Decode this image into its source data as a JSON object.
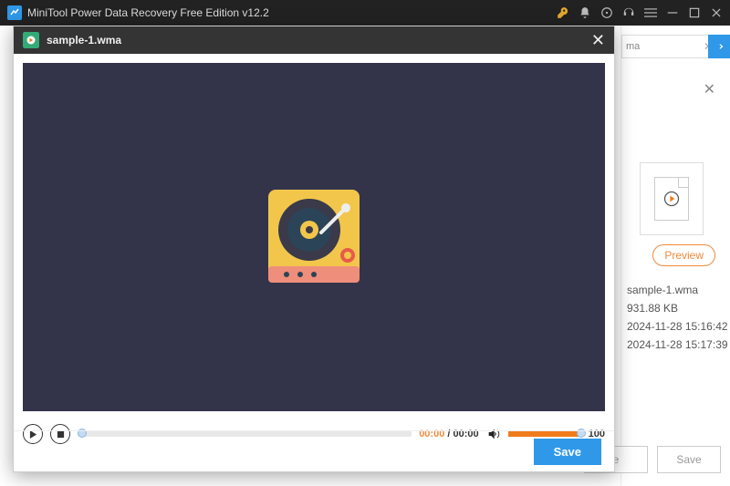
{
  "app": {
    "title": "MiniTool Power Data Recovery Free Edition v12.2"
  },
  "sidebar": {
    "search_fragment": "ma",
    "preview_label": "Preview",
    "file": {
      "name": "sample-1.wma",
      "size": "931.88 KB",
      "date1": "2024-11-28 15:16:42",
      "date2": "2024-11-28 15:17:39"
    },
    "recover_label": "e",
    "save_label": "Save"
  },
  "modal": {
    "filename": "sample-1.wma",
    "current_time": "00:00",
    "duration": "00:00",
    "separator": " / ",
    "volume": "100",
    "save_label": "Save"
  }
}
